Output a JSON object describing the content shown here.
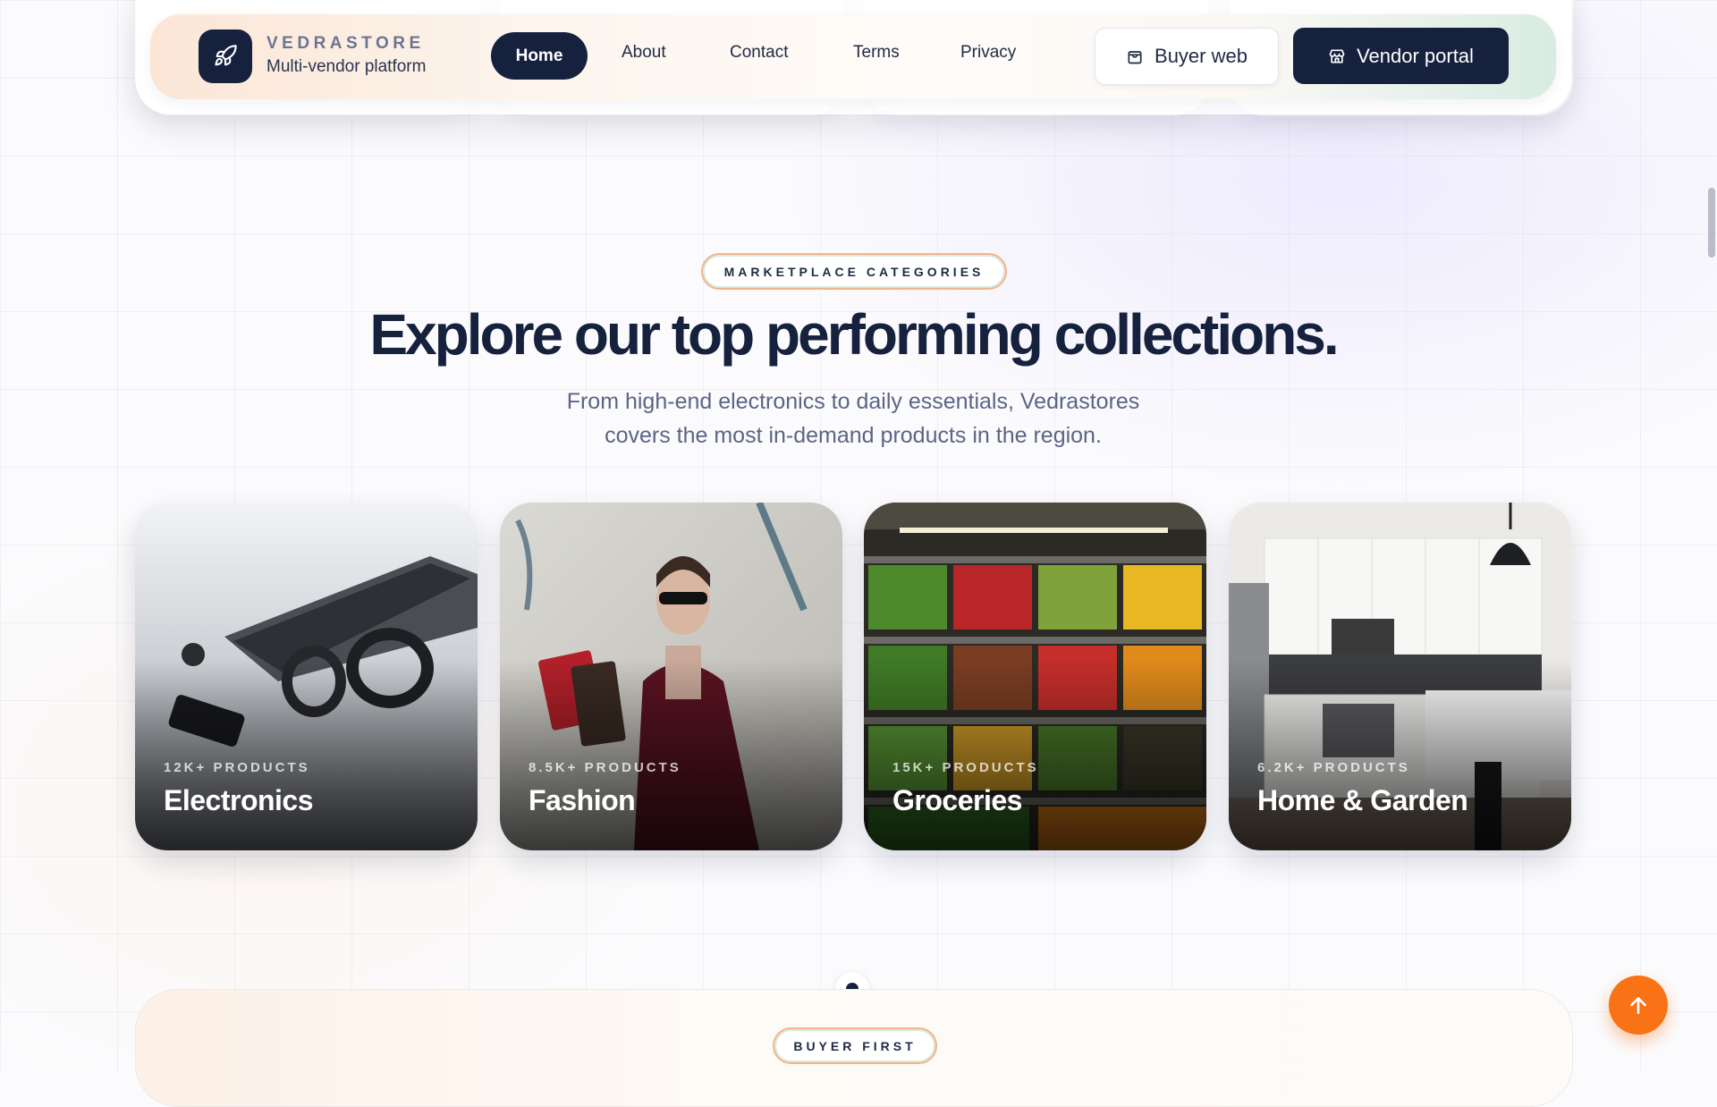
{
  "nav": {
    "brand_name": "VEDRASTORE",
    "brand_tagline": "Multi-vendor platform",
    "logo_icon": "rocket-icon",
    "links": [
      "Home",
      "About",
      "Contact",
      "Terms",
      "Privacy"
    ],
    "active_link": "Home",
    "buyer_button": "Buyer web",
    "buyer_icon": "shopping-bag-icon",
    "vendor_button": "Vendor portal",
    "vendor_icon": "store-icon"
  },
  "section": {
    "badge": "MARKETPLACE CATEGORIES",
    "heading": "Explore our top performing collections.",
    "subtitle_line1": "From high-end electronics to daily essentials, Vedrastores",
    "subtitle_line2": "covers the most in-demand products in the region."
  },
  "categories": [
    {
      "count": "12K+ PRODUCTS",
      "title": "Electronics"
    },
    {
      "count": "8.5K+ PRODUCTS",
      "title": "Fashion"
    },
    {
      "count": "15K+ PRODUCTS",
      "title": "Groceries"
    },
    {
      "count": "6.2K+ PRODUCTS",
      "title": "Home & Garden"
    }
  ],
  "pagination": {
    "current": 1,
    "total": 1
  },
  "next_section": {
    "badge": "BUYER FIRST"
  },
  "scroll_top_icon": "arrow-up-icon",
  "colors": {
    "navy": "#16213e",
    "accent_orange": "#f97316",
    "muted_text": "#5b6584"
  }
}
